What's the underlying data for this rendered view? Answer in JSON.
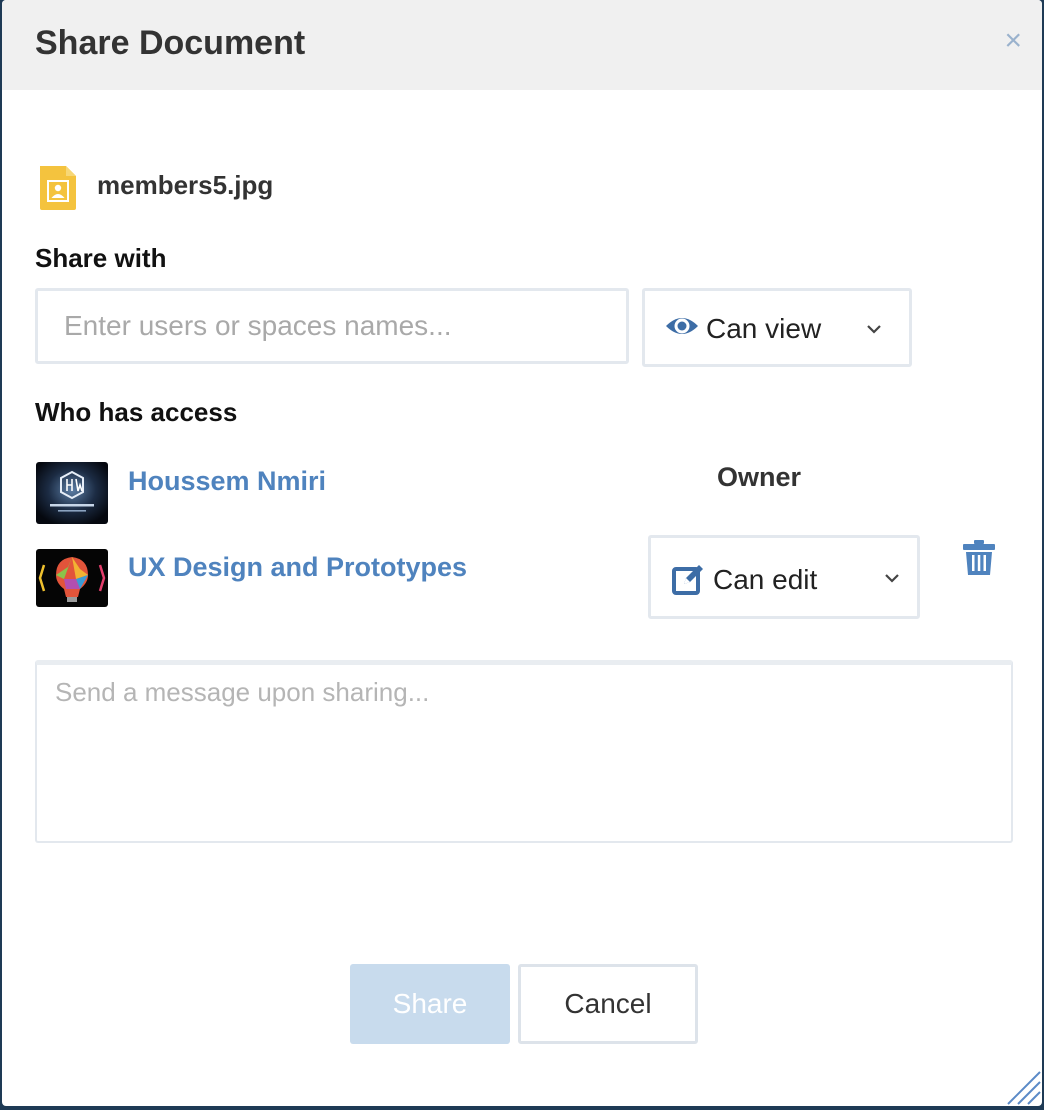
{
  "dialog": {
    "title": "Share Document",
    "close_glyph": "×"
  },
  "file": {
    "name": "members5.jpg",
    "icon": "image-file-icon",
    "icon_color": "#f4c33e"
  },
  "share_with": {
    "label": "Share with",
    "input_placeholder": "Enter users or spaces names...",
    "input_value": "",
    "permission": {
      "icon": "eye-icon",
      "label": "Can view"
    }
  },
  "access": {
    "label": "Who has access",
    "members": [
      {
        "name": "Houssem Nmiri",
        "role": "Owner",
        "avatar": "company-logo-avatar"
      },
      {
        "name": "UX Design and Prototypes",
        "permission": {
          "icon": "edit-icon",
          "label": "Can edit"
        },
        "avatar": "lightbulb-avatar",
        "remove_icon": "trash-icon"
      }
    ]
  },
  "message": {
    "placeholder": "Send a message upon sharing...",
    "value": ""
  },
  "actions": {
    "share_label": "Share",
    "cancel_label": "Cancel"
  },
  "colors": {
    "accent": "#4f83be",
    "icon_blue": "#3d6da6",
    "share_disabled_bg": "#c8dbed",
    "header_bg": "#f0f0f0"
  }
}
